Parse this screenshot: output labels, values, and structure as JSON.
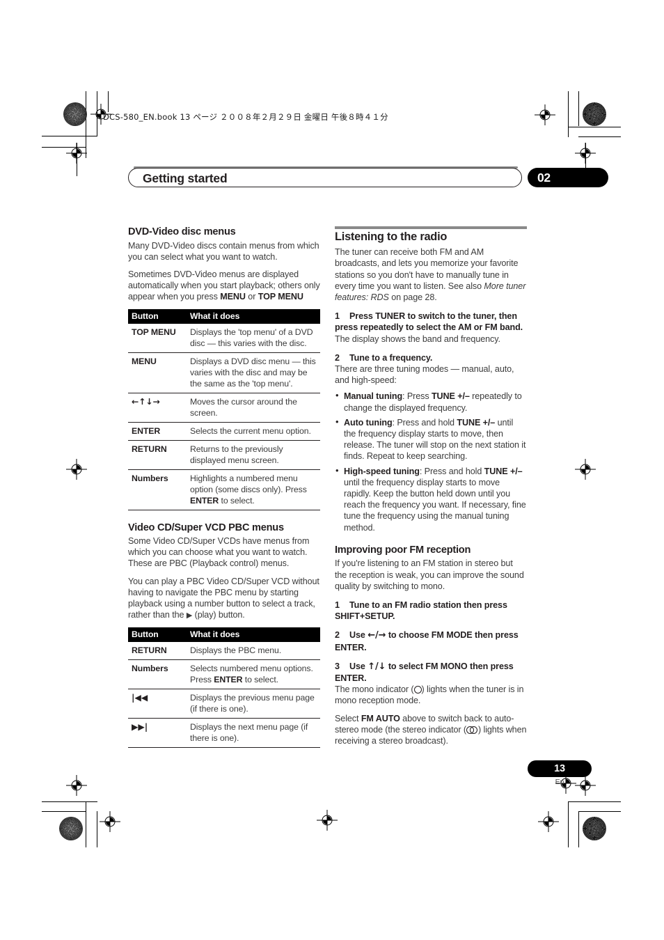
{
  "print_slug": "DCS-580_EN.book   13 ページ   ２００８年２月２９日   金曜日   午後８時４１分",
  "running_head": {
    "title": "Getting started",
    "chapter_number": "02"
  },
  "footer": {
    "page_number": "13",
    "language_code": "En"
  },
  "left_column": {
    "section1": {
      "heading": "DVD-Video disc menus",
      "para1": "Many DVD-Video discs contain menus from which you can select what you want to watch.",
      "para2_pre": "Sometimes DVD-Video menus are displayed automatically when you start playback; others only appear when you press ",
      "para2_b1": "MENU",
      "para2_mid": " or ",
      "para2_b2": "TOP MENU",
      "table": {
        "header_button": "Button",
        "header_what": "What it does",
        "rows": [
          {
            "key": "TOP MENU",
            "desc": "Displays the 'top menu' of a DVD disc — this varies with the disc."
          },
          {
            "key": "MENU",
            "desc": "Displays a DVD disc menu — this varies with the disc and may be the same as the 'top menu'."
          },
          {
            "key": "←↑↓→",
            "key_is_glyph": true,
            "desc": "Moves the cursor around the screen."
          },
          {
            "key": "ENTER",
            "desc": "Selects the current menu option."
          },
          {
            "key": "RETURN",
            "desc": "Returns to the previously displayed menu screen."
          },
          {
            "key": "Numbers",
            "desc_pre": "Highlights a numbered menu option (some discs only). Press ",
            "desc_b": "ENTER",
            "desc_post": " to select."
          }
        ]
      }
    },
    "section2": {
      "heading": "Video CD/Super VCD PBC menus",
      "para1": "Some Video CD/Super VCDs have menus from which you can choose what you want to watch. These are PBC (Playback control) menus.",
      "para2_pre": "You can play a PBC Video CD/Super VCD without having to navigate the PBC menu by starting playback using a number button to select a track, rather than the ",
      "para2_glyph": "▶",
      "para2_post": " (play) button.",
      "table": {
        "header_button": "Button",
        "header_what": "What it does",
        "rows": [
          {
            "key": "RETURN",
            "desc": "Displays the PBC menu."
          },
          {
            "key": "Numbers",
            "desc_pre": "Selects numbered menu options. Press ",
            "desc_b": "ENTER",
            "desc_post": " to select."
          },
          {
            "key": "|◀◀",
            "key_is_glyph": true,
            "desc": "Displays the previous menu page (if there is one)."
          },
          {
            "key": "▶▶|",
            "key_is_glyph": true,
            "desc": "Displays the next menu page (if there is one)."
          }
        ]
      }
    }
  },
  "right_column": {
    "section1": {
      "heading": "Listening to the radio",
      "intro_pre": "The tuner can receive both FM and AM broadcasts, and lets you memorize your favorite stations so you don't have to manually tune in every time you want to listen. See also ",
      "intro_italic": "More tuner features: RDS",
      "intro_post": " on page 28.",
      "step1": {
        "num": "1",
        "title_pre": "Press TUNER to switch to the tuner, then press repeatedly to select the AM or FM band.",
        "body": "The display shows the band and frequency."
      },
      "step2": {
        "num": "2",
        "title": "Tune to a frequency.",
        "body": "There are three tuning modes — manual, auto, and high-speed:"
      },
      "bullets": [
        {
          "label": "Manual tuning",
          "text_pre": ": Press ",
          "bold_mid": "TUNE +/–",
          "text_post": " repeatedly to change the displayed frequency."
        },
        {
          "label": "Auto tuning",
          "text_pre": ": Press and hold ",
          "bold_mid": "TUNE +/–",
          "text_post": " until the frequency display starts to move, then release. The tuner will stop on the next station it finds. Repeat to keep searching."
        },
        {
          "label": "High-speed tuning",
          "text_pre": ": Press and hold ",
          "bold_mid": "TUNE +/–",
          "text_post": " until the frequency display starts to move rapidly. Keep the button held down until you reach the frequency you want. If necessary, fine tune the frequency using the manual tuning method."
        }
      ]
    },
    "section2": {
      "heading": "Improving poor FM reception",
      "intro": "If you're listening to an FM station in stereo but the reception is weak, you can improve the sound quality by switching to mono.",
      "step1": {
        "num": "1",
        "title": "Tune to an FM radio station then press SHIFT+SETUP."
      },
      "step2": {
        "num": "2",
        "title_pre": "Use ",
        "title_glyph": "←/→",
        "title_post": " to choose FM MODE then press ENTER."
      },
      "step3": {
        "num": "3",
        "title_pre": "Use ",
        "title_glyph": "↑/↓",
        "title_post": " to select FM MONO then press ENTER.",
        "body_pre": "The mono indicator (",
        "body_post": ") lights when the tuner is in mono reception mode."
      },
      "closing": {
        "pre": "Select ",
        "bold": "FM AUTO",
        "mid": " above to switch back to auto-stereo mode (the stereo indicator (",
        "post": ") lights when receiving a stereo broadcast)."
      }
    }
  }
}
